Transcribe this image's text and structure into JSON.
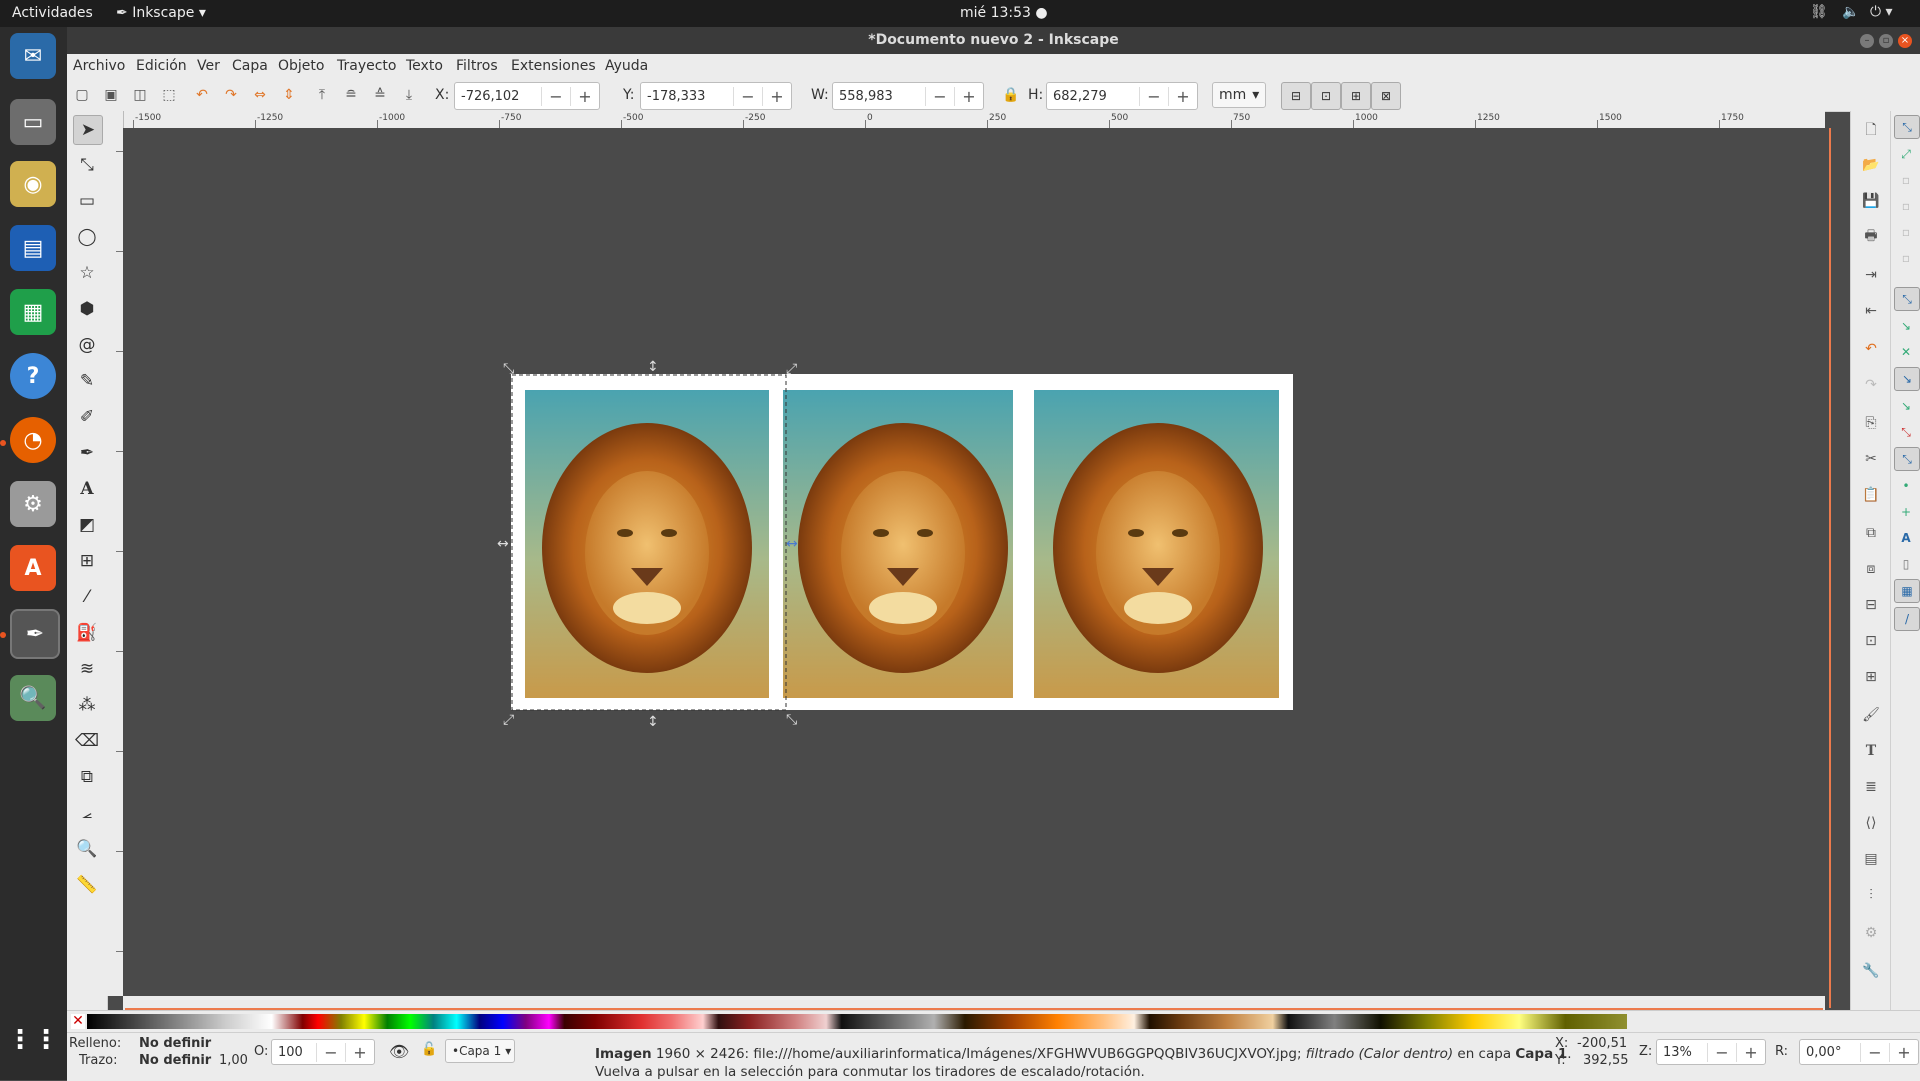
{
  "topbar": {
    "activities": "Actividades",
    "app_menu": "Inkscape",
    "clock": "mié 13:53",
    "indicators": [
      "network-icon",
      "volume-icon",
      "power-icon"
    ]
  },
  "window": {
    "title": "*Documento nuevo 2 - Inkscape"
  },
  "menubar": {
    "items": [
      "Archivo",
      "Edición",
      "Ver",
      "Capa",
      "Objeto",
      "Trayecto",
      "Texto",
      "Filtros",
      "Extensiones",
      "Ayuda"
    ]
  },
  "controls": {
    "x_label": "X:",
    "x_value": "-726,102",
    "y_label": "Y:",
    "y_value": "-178,333",
    "w_label": "W:",
    "w_value": "558,983",
    "h_label": "H:",
    "h_value": "682,279",
    "unit": "mm",
    "minus": "−",
    "plus": "+"
  },
  "ruler": {
    "labels": [
      "-1500",
      "-1250",
      "-1000",
      "-750",
      "-500",
      "-250",
      "0",
      "250",
      "500",
      "750",
      "1000",
      "1250",
      "1500",
      "1750"
    ]
  },
  "status": {
    "fill_label": "Relleno:",
    "fill_value": "No definir",
    "stroke_label": "Trazo:",
    "stroke_value": "No definir",
    "stroke_width": "1,00",
    "opacity_label": "O:",
    "opacity_value": "100",
    "layer": "•Capa 1",
    "message_bold": "Imagen",
    "message_1": " 1960 × 2426: file:///home/auxiliarinformatica/Imágenes/XFGHWVUB6GGPQQBIV36UCJXVOY.jpg; ",
    "message_italic": "filtrado (Calor dentro)",
    "message_2": " en capa ",
    "message_layer": "Capa 1",
    "message_3": ". Vuelva a pulsar en la selección para conmutar los tiradores de escalado/rotación.",
    "x_coord_label": "X:",
    "x_coord": "-200,51",
    "y_coord_label": "Y:",
    "y_coord": "392,55",
    "zoom_label": "Z:",
    "zoom_value": "13%",
    "rotation_label": "R:",
    "rotation_value": "0,00°"
  },
  "colors": {
    "accent": "#e95420",
    "selection_dash": "#333333",
    "canvas_bg": "#4a4a4a"
  }
}
